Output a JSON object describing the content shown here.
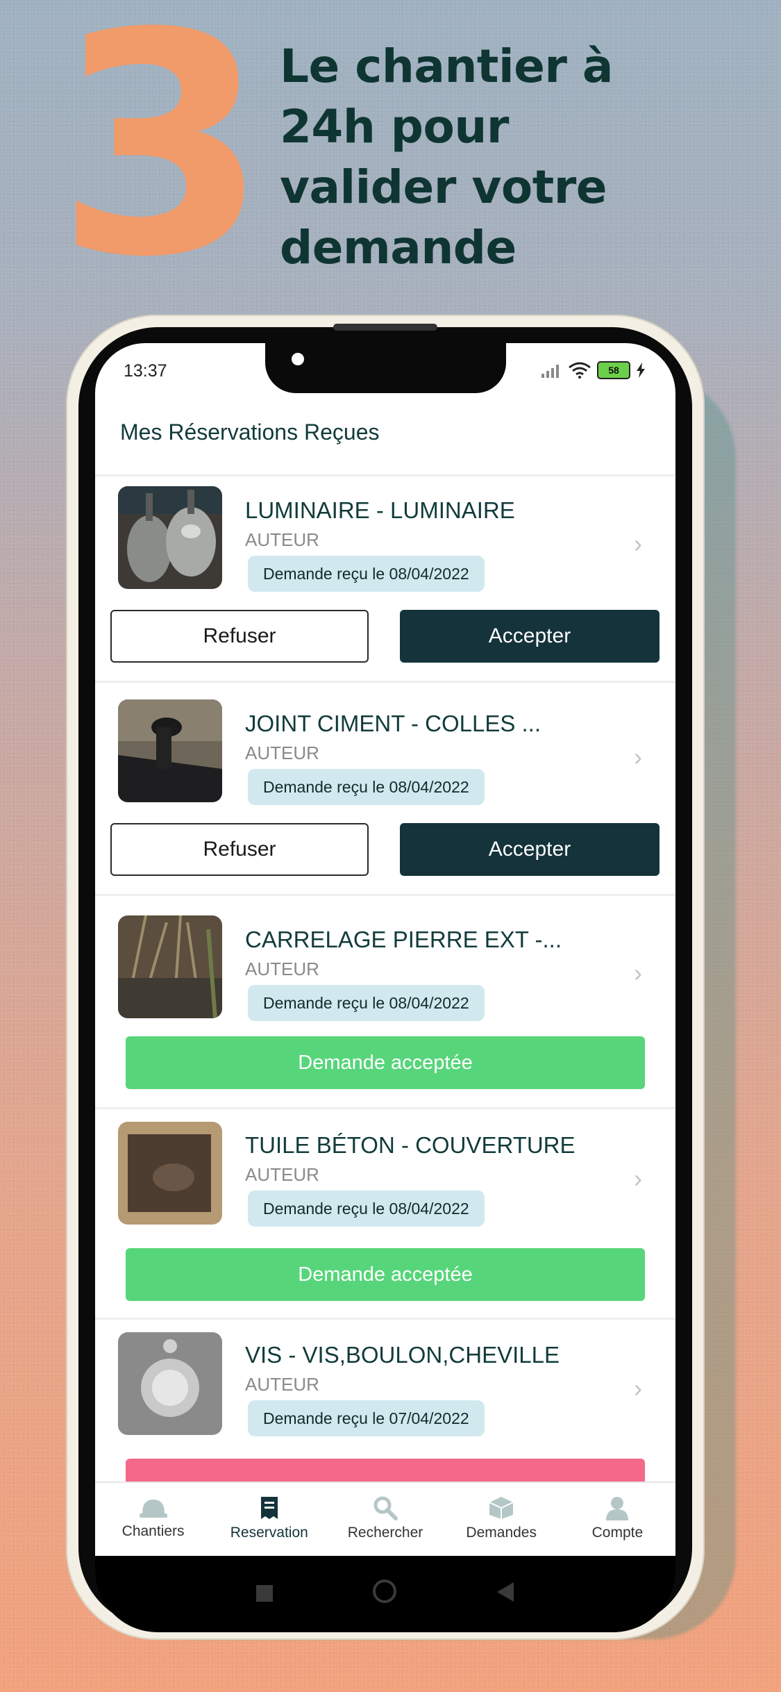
{
  "promo": {
    "step_number": "3",
    "headline_lines": [
      "Le chantier à",
      "24h pour",
      "valider votre",
      "demande"
    ]
  },
  "status_bar": {
    "time": "13:37",
    "battery": "58"
  },
  "header": {
    "title": "Mes Réservations Reçues"
  },
  "reservations": [
    {
      "title": "LUMINAIRE - LUMINAIRE",
      "author": "AUTEUR",
      "date": "Demande reçu le 08/04/2022",
      "refuse_label": "Refuser",
      "accept_label": "Accepter"
    },
    {
      "title": "JOINT CIMENT - COLLES ...",
      "author": "AUTEUR",
      "date": "Demande reçu le 08/04/2022",
      "refuse_label": "Refuser",
      "accept_label": "Accepter"
    },
    {
      "title": "CARRELAGE PIERRE EXT -...",
      "author": "AUTEUR",
      "date": "Demande reçu le 08/04/2022",
      "status_label": "Demande acceptée"
    },
    {
      "title": "TUILE BÉTON - COUVERTURE",
      "author": "AUTEUR",
      "date": "Demande reçu le 08/04/2022",
      "status_label": "Demande acceptée"
    },
    {
      "title": "VIS - VIS,BOULON,CHEVILLE",
      "author": "AUTEUR",
      "date": "Demande reçu le 07/04/2022"
    }
  ],
  "tabs": [
    {
      "label": "Chantiers",
      "icon": "helmet-icon"
    },
    {
      "label": "Reservation",
      "icon": "receipt-icon"
    },
    {
      "label": "Rechercher",
      "icon": "search-icon"
    },
    {
      "label": "Demandes",
      "icon": "box-icon"
    },
    {
      "label": "Compte",
      "icon": "user-icon"
    }
  ],
  "colors": {
    "accent_dark": "#14333a",
    "accepted": "#57d57a",
    "refused": "#f4698a",
    "active_tab": "#14333a",
    "inactive_tab": "#b5c6c6"
  }
}
